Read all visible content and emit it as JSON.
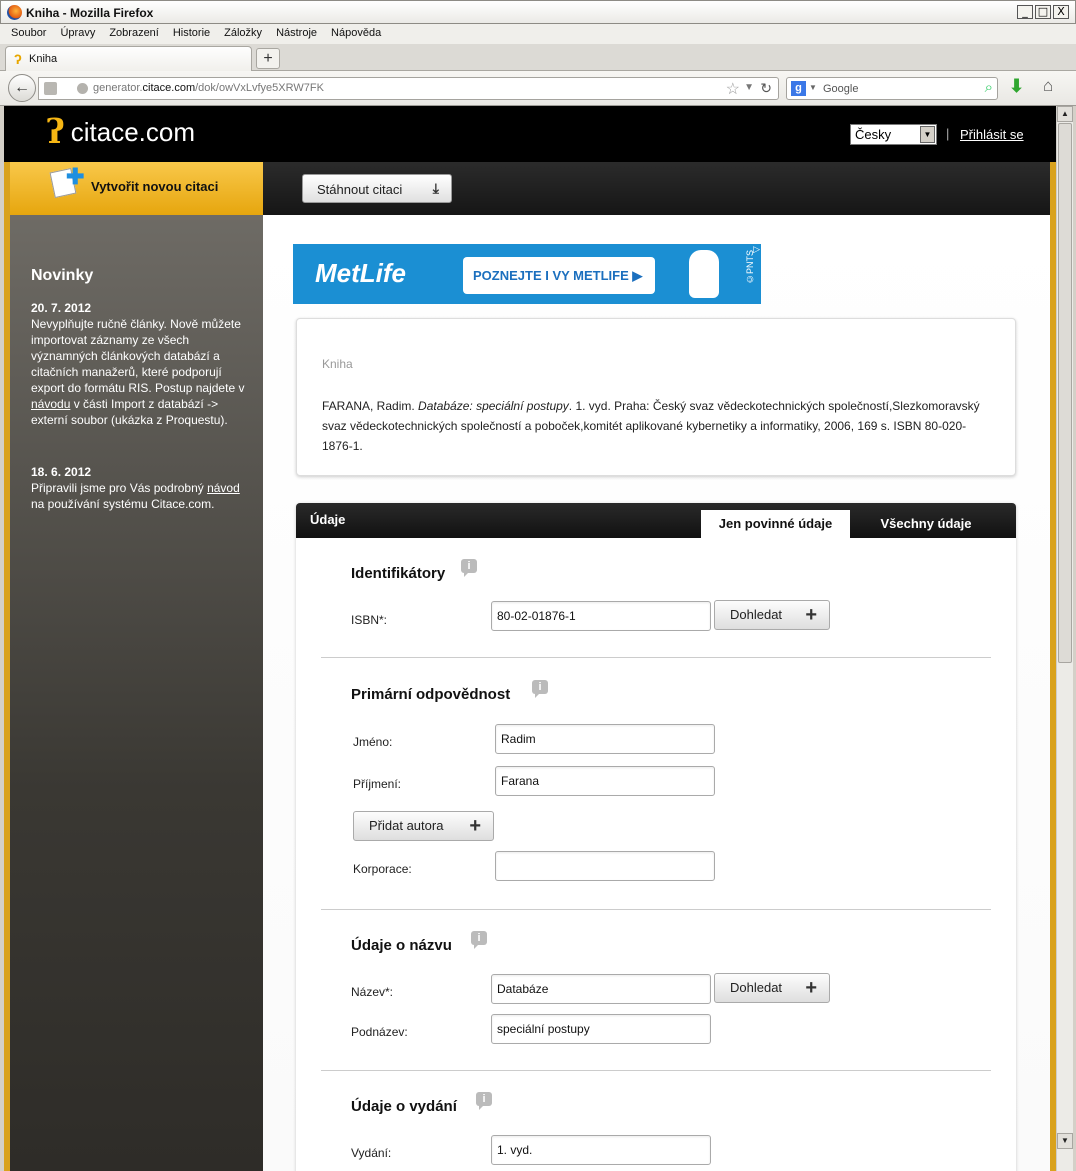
{
  "window": {
    "title": "Kniha - Mozilla Firefox",
    "controls": [
      "_",
      "□",
      "X"
    ]
  },
  "menu": [
    "Soubor",
    "Úpravy",
    "Zobrazení",
    "Historie",
    "Záložky",
    "Nástroje",
    "Nápověda"
  ],
  "tab": {
    "label": "Kniha",
    "new_tab": "+"
  },
  "nav": {
    "url_host_pre": "generator.",
    "url_host": "citace.com",
    "url_path": "/dok/owVxLvfye5XRW7FK",
    "search_placeholder": "Google"
  },
  "site": {
    "logo_text": "citace.com",
    "language": "Česky",
    "separator": "|",
    "login": "Přihlásit se",
    "create_button": "Vytvořit novou citaci",
    "download_button": "Stáhnout citaci"
  },
  "sidebar": {
    "heading": "Novinky",
    "news": [
      {
        "date": "20. 7. 2012",
        "text_before": "Nevyplňujte ručně články. Nově můžete importovat záznamy ze všech významných článkových databází a citačních manažerů, které podporují export do formátu RIS. Postup najdete v ",
        "link": "návodu",
        "text_after": " v části Import z databází -> externí soubor (ukázka z Proquestu)."
      },
      {
        "date": "18. 6. 2012",
        "text_before": "Připravili jsme pro Vás podrobný ",
        "link": "návod",
        "text_after": " na používání systému Citace.com."
      }
    ]
  },
  "ad": {
    "brand": "MetLife",
    "cta": "POZNEJTE I VY METLIFE ▶",
    "credit": "©PNTS"
  },
  "citation": {
    "type": "Kniha",
    "author": "FARANA, Radim. ",
    "title": "Databáze: speciální postupy",
    "rest": ". 1. vyd. Praha: Český svaz vědeckotechnických společností,Slezkomoravský svaz vědeckotechnických společností a poboček,komitét aplikované kybernetiky a informatiky, 2006, 169 s. ISBN 80-020-1876-1."
  },
  "form": {
    "title": "Údaje",
    "tab_required": "Jen povinné údaje",
    "tab_all": "Všechny údaje",
    "lookup_label": "Dohledat",
    "sections": {
      "identifiers": {
        "title": "Identifikátory",
        "isbn_label": "ISBN*:",
        "isbn_value": "80-02-01876-1"
      },
      "primary": {
        "title": "Primární odpovědnost",
        "first_name_label": "Jméno:",
        "first_name_value": "Radim",
        "last_name_label": "Příjmení:",
        "last_name_value": "Farana",
        "add_author": "Přidat autora",
        "corporation_label": "Korporace:",
        "corporation_value": ""
      },
      "title_info": {
        "title": "Údaje o názvu",
        "name_label": "Název*:",
        "name_value": "Databáze",
        "subtitle_label": "Podnázev:",
        "subtitle_value": "speciální postupy"
      },
      "edition": {
        "title": "Údaje o vydání",
        "edition_label": "Vydání:",
        "edition_value": "1. vyd."
      }
    }
  }
}
